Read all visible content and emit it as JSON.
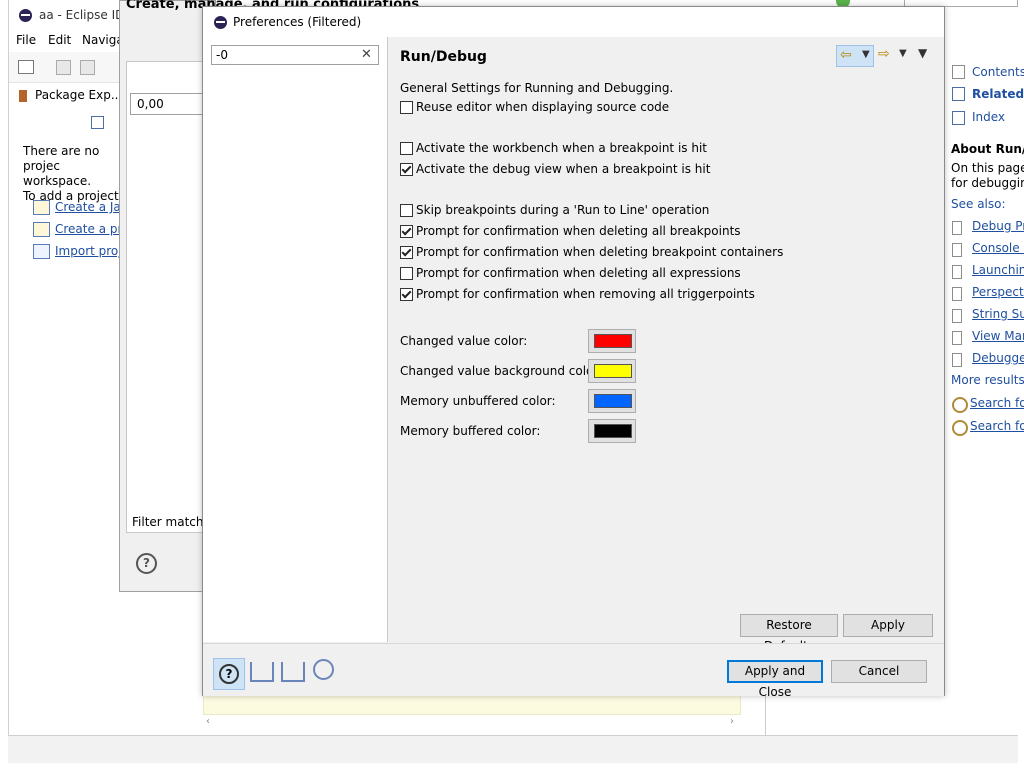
{
  "eclipse": {
    "title": "aa - Eclipse IDE",
    "menu": [
      "File",
      "Edit",
      "Navigat"
    ],
    "package_explorer_tab": "Package Exp...",
    "no_projects_text": [
      "There are no projec",
      "workspace."
    ],
    "add_project_text": "To add a project:",
    "links": [
      "Create a Java",
      "Create a proj",
      "Import proje"
    ]
  },
  "run_config": {
    "title": "Create, manage, and run configurations",
    "filter_value": "0,00",
    "filter_matched": "Filter matched"
  },
  "prefs": {
    "title": "Preferences (Filtered)",
    "filter_value": "-0",
    "page_title": "Run/Debug",
    "description": "General Settings for Running and Debugging.",
    "checkboxes": [
      {
        "label": "Reuse editor when displaying source code",
        "checked": false
      },
      {
        "label": "Activate the workbench when a breakpoint is hit",
        "checked": false
      },
      {
        "label": "Activate the debug view when a breakpoint is hit",
        "checked": true
      },
      {
        "label": "Skip breakpoints during a 'Run to Line' operation",
        "checked": false
      },
      {
        "label": "Prompt for confirmation when deleting all breakpoints",
        "checked": true
      },
      {
        "label": "Prompt for confirmation when deleting breakpoint containers",
        "checked": true
      },
      {
        "label": "Prompt for confirmation when deleting all expressions",
        "checked": false
      },
      {
        "label": "Prompt for confirmation when removing all triggerpoints",
        "checked": true
      }
    ],
    "colors": [
      {
        "label": "Changed value color:",
        "color": "#ff0000"
      },
      {
        "label": "Changed value background color:",
        "color": "#ffff00"
      },
      {
        "label": "Memory unbuffered color:",
        "color": "#0066ff"
      },
      {
        "label": "Memory buffered color:",
        "color": "#000000"
      }
    ],
    "restore_defaults": "Restore Defaults",
    "apply": "Apply",
    "apply_and_close": "Apply and Close",
    "cancel": "Cancel"
  },
  "help": {
    "contents": "Contents",
    "related": "Related T",
    "index": "Index",
    "about": "About Run/De",
    "about_text": [
      "On this page,",
      "for debugging"
    ],
    "see_also": "See also:",
    "see_also_items": [
      "Debug Pre",
      "Console P",
      "Launching",
      "Perspectiv",
      "String Sub",
      "View Man",
      "Debugger"
    ],
    "more_results": "More results:",
    "search_items": [
      "Search for",
      "Search for"
    ]
  }
}
